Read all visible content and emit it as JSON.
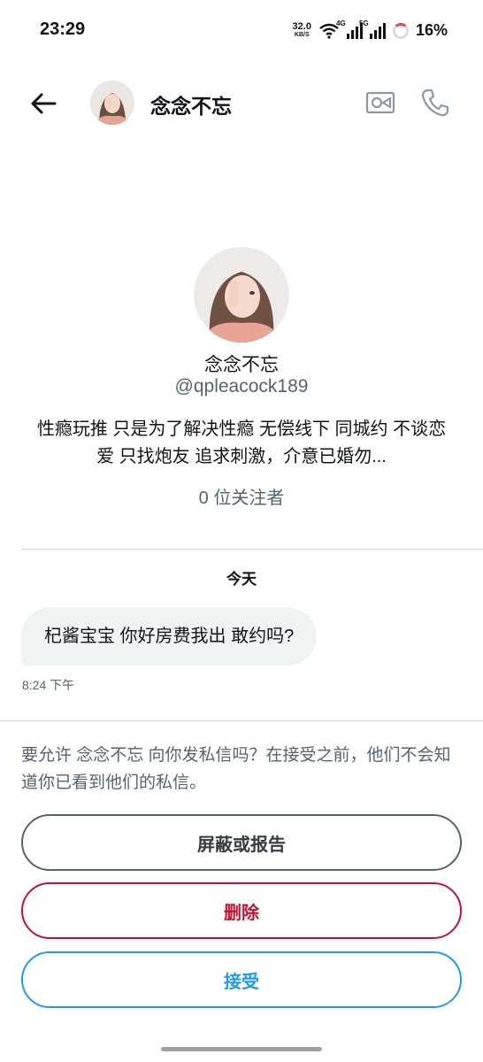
{
  "status_bar": {
    "time": "23:29",
    "net_speed_value": "32.0",
    "net_speed_unit": "KB/S",
    "network_4g": "4G",
    "network_5g": "5G",
    "battery": "16%"
  },
  "header": {
    "name": "念念不忘"
  },
  "profile": {
    "name": "念念不忘",
    "handle": "@qpleacock189",
    "bio": "性瘾玩推 只是为了解决性瘾 无偿线下 同城约 不谈恋爱 只找炮友 追求刺激，介意已婚勿...",
    "followers": "0 位关注者"
  },
  "conversation": {
    "date_label": "今天",
    "messages": [
      {
        "text": "杞酱宝宝 你好房费我出  敢约吗?",
        "time": "8:24 下午"
      }
    ]
  },
  "request": {
    "prompt": "要允许 念念不忘 向你发私信吗？在接受之前，他们不会知道你已看到他们的私信。",
    "block_label": "屏蔽或报告",
    "delete_label": "删除",
    "accept_label": "接受"
  },
  "colors": {
    "accent": "#1d9bf0",
    "danger": "#c8102e",
    "secondary_text": "#536471"
  }
}
